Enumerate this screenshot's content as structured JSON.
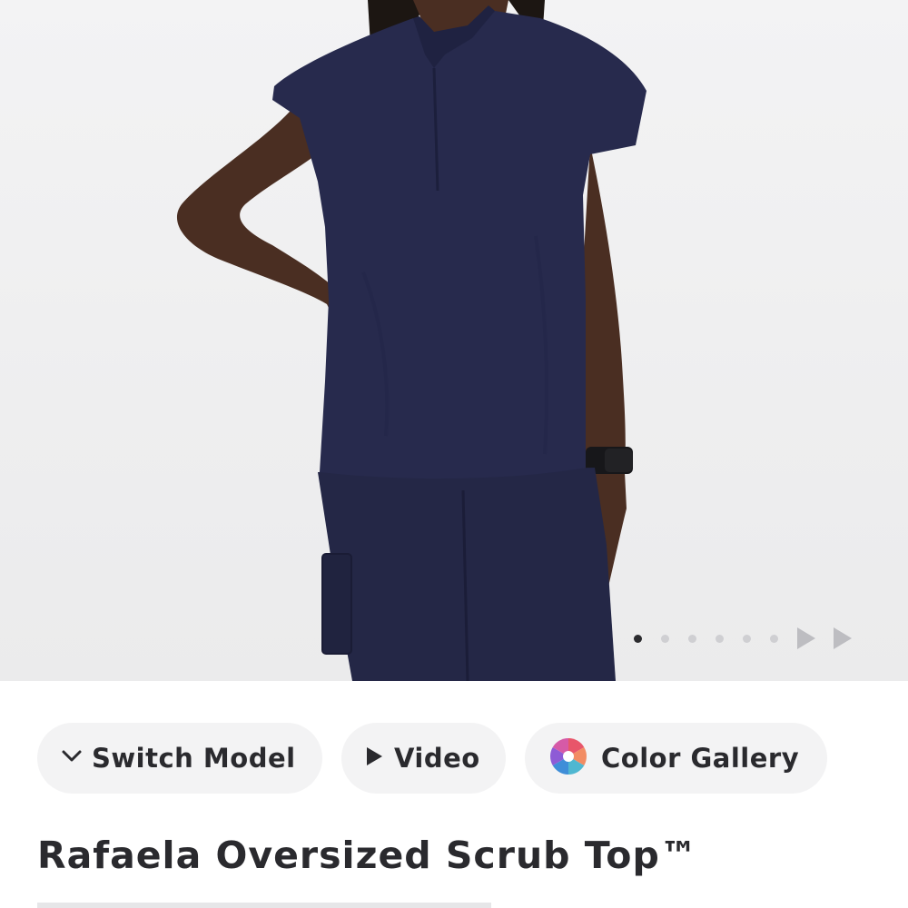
{
  "product": {
    "title": "Rafaela Oversized Scrub Top™",
    "image_alt": "Model wearing navy Rafaela Oversized Scrub Top",
    "garment_color": "#272a4d"
  },
  "carousel": {
    "total_images": 6,
    "active_index": 0
  },
  "actions": {
    "switch_model": {
      "label": "Switch Model",
      "icon": "chevron-down-icon"
    },
    "video": {
      "label": "Video",
      "icon": "play-icon"
    },
    "color_gallery": {
      "label": "Color Gallery",
      "icon": "color-wheel-icon"
    }
  }
}
